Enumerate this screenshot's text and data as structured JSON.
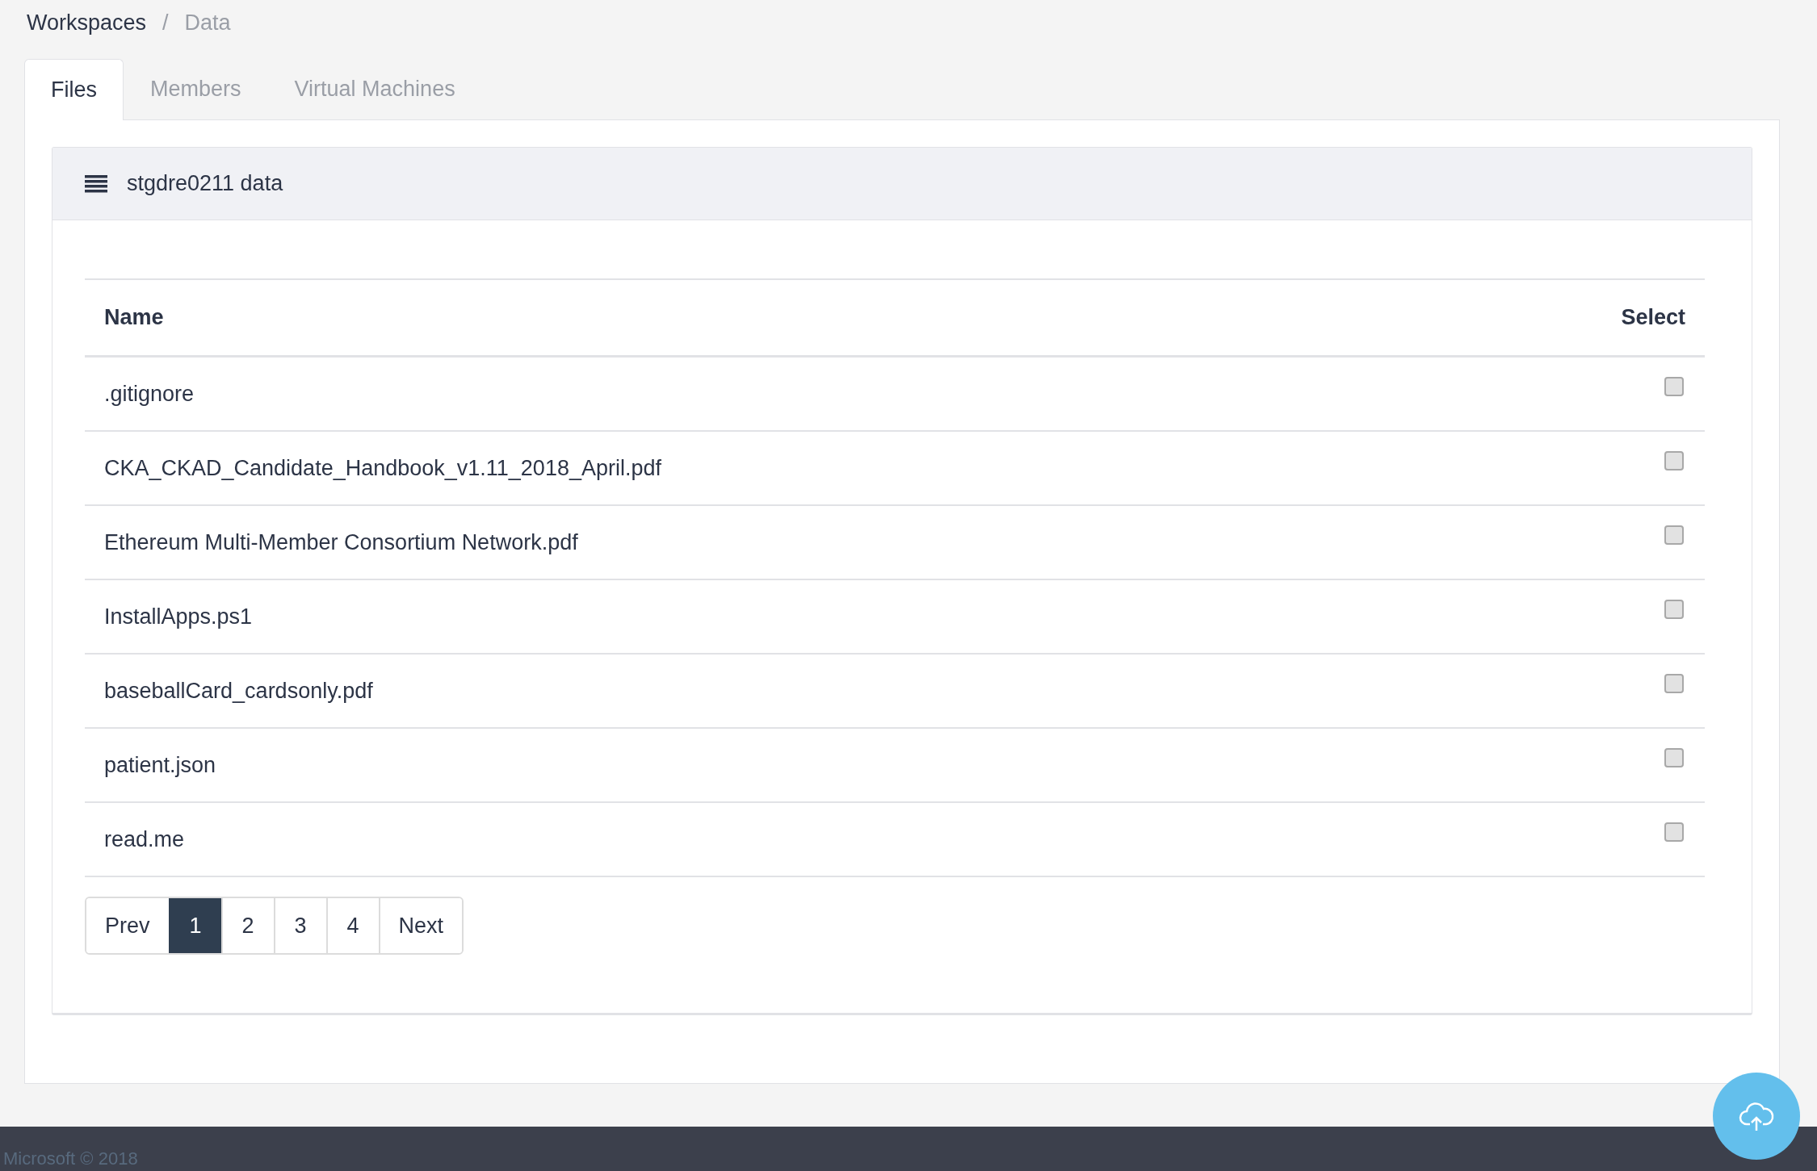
{
  "breadcrumb": [
    "Workspaces",
    "Data"
  ],
  "breadcrumb_separator": "/",
  "tabs": [
    {
      "label": "Files",
      "selected": true
    },
    {
      "label": "Members",
      "selected": false
    },
    {
      "label": "Virtual Machines",
      "selected": false
    }
  ],
  "card": {
    "title": "stgdre0211 data"
  },
  "table": {
    "columns": [
      "Name",
      "Select"
    ],
    "rows": [
      {
        "name": ".gitignore",
        "checked": false
      },
      {
        "name": "CKA_CKAD_Candidate_Handbook_v1.11_2018_April.pdf",
        "checked": false
      },
      {
        "name": "Ethereum Multi-Member Consortium Network.pdf",
        "checked": false
      },
      {
        "name": "InstallApps.ps1",
        "checked": false
      },
      {
        "name": "baseballCard_cardsonly.pdf",
        "checked": false
      },
      {
        "name": "patient.json",
        "checked": false
      },
      {
        "name": "read.me",
        "checked": false
      }
    ]
  },
  "pagination": [
    {
      "label": "Prev",
      "selected": false
    },
    {
      "label": "1",
      "selected": true
    },
    {
      "label": "2",
      "selected": false
    },
    {
      "label": "3",
      "selected": false
    },
    {
      "label": "4",
      "selected": false
    },
    {
      "label": "Next",
      "selected": false
    }
  ],
  "footer": {
    "text": "Microsoft © 2018"
  }
}
